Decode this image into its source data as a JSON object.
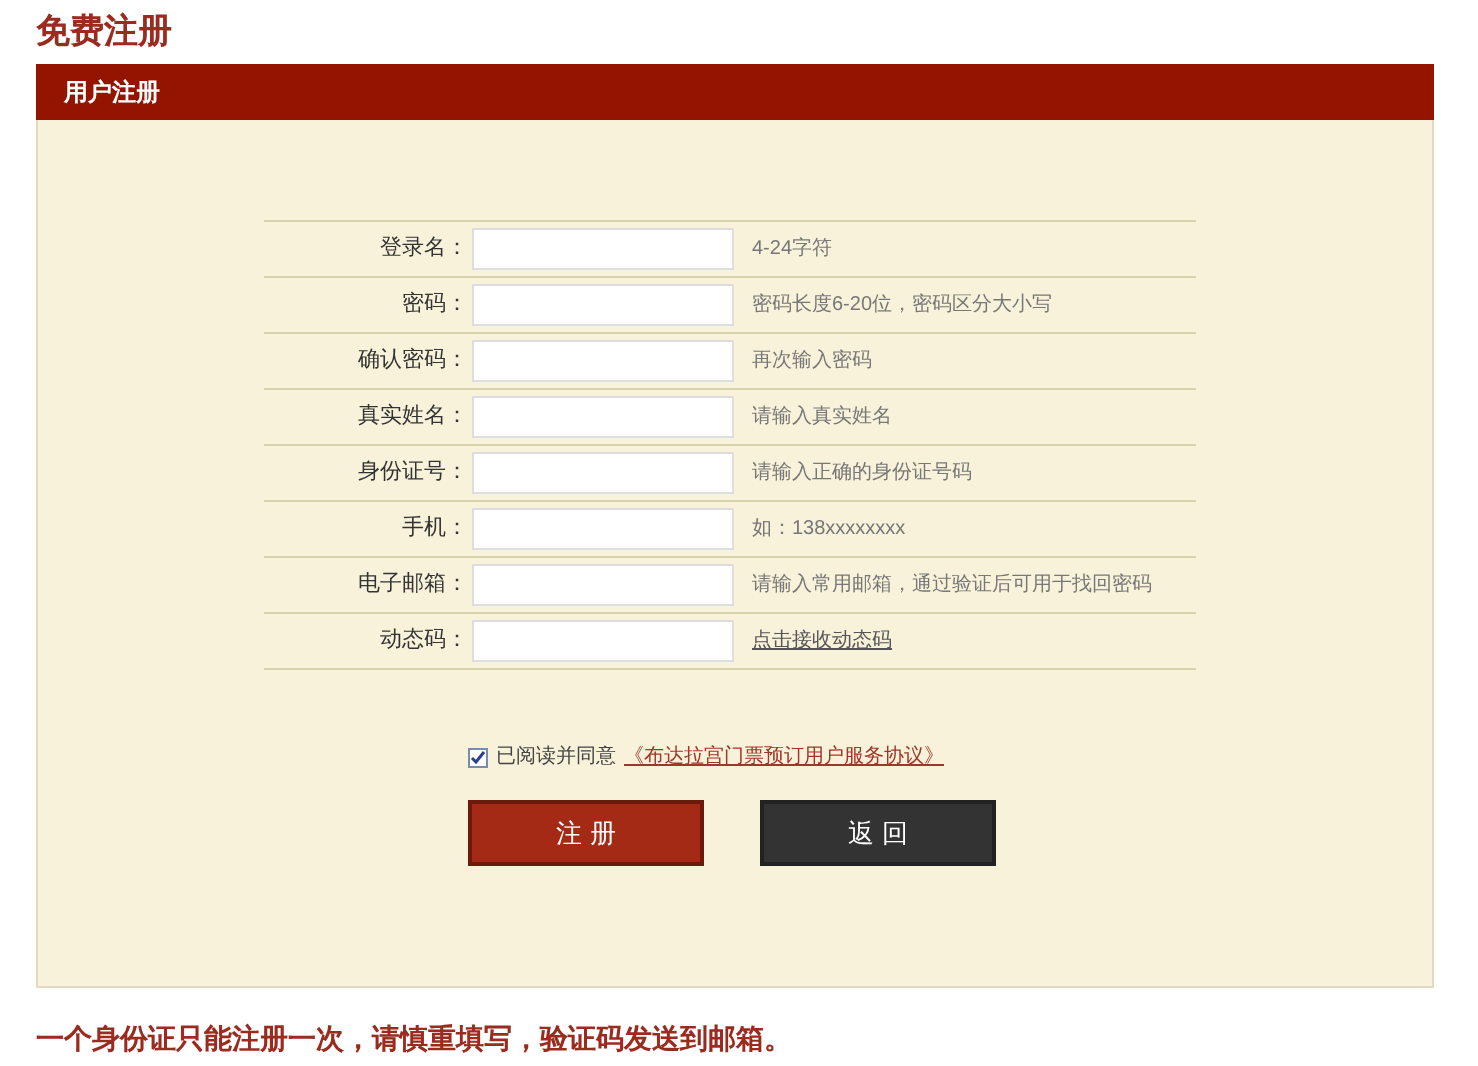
{
  "page_title": "免费注册",
  "panel_title": "用户注册",
  "fields": [
    {
      "label": "登录名：",
      "hint": "4-24字符",
      "kind": "text"
    },
    {
      "label": "密码：",
      "hint": "密码长度6-20位，密码区分大小写",
      "kind": "text"
    },
    {
      "label": "确认密码：",
      "hint": "再次输入密码",
      "kind": "text"
    },
    {
      "label": "真实姓名：",
      "hint": "请输入真实姓名",
      "kind": "text"
    },
    {
      "label": "身份证号：",
      "hint": "请输入正确的身份证号码",
      "kind": "text"
    },
    {
      "label": "手机：",
      "hint": "如：138xxxxxxxx",
      "kind": "text"
    },
    {
      "label": "电子邮箱：",
      "hint": "请输入常用邮箱，通过验证后可用于找回密码",
      "kind": "text"
    },
    {
      "label": "动态码：",
      "hint": "点击接收动态码",
      "kind": "link"
    }
  ],
  "agreement": {
    "checked": true,
    "text": "已阅读并同意",
    "link": "《布达拉宫门票预订用户服务协议》"
  },
  "buttons": [
    {
      "label": "注 册",
      "kind": "primary"
    },
    {
      "label": "返 回",
      "kind": "secondary"
    }
  ],
  "footer_note": "一个身份证只能注册一次，请慎重填写，验证码发送到邮箱。"
}
